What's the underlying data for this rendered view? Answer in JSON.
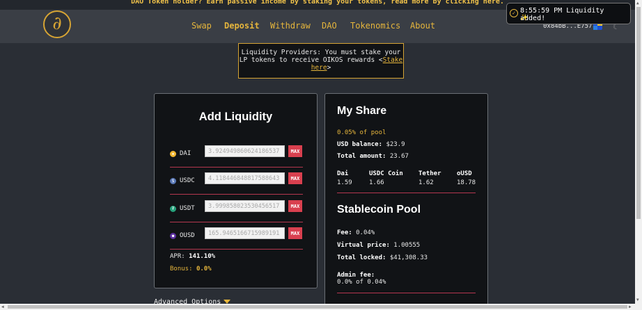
{
  "banner": {
    "text": "DAO Token holder? Earn passive income by staking your tokens, read more by clicking here."
  },
  "logo": {
    "glyph": "∂"
  },
  "nav": {
    "items": [
      {
        "label": "Swap",
        "active": false
      },
      {
        "label": "Deposit",
        "active": true
      },
      {
        "label": "Withdraw",
        "active": false
      },
      {
        "label": "DAO",
        "active": false
      },
      {
        "label": "Tokenomics",
        "active": false
      },
      {
        "label": "About",
        "active": false
      }
    ]
  },
  "wallet": {
    "address": "0x84bB...E757",
    "icon": "wallet-avatar-icon"
  },
  "theme_toggle": {
    "icon": "moon-icon"
  },
  "toast": {
    "time": "8:55:59 PM",
    "message": "8:55:59 PM Liquidity added!",
    "emoji": "✨"
  },
  "notice": {
    "text_before": "Liquidity Providers: You must stake your LP tokens to receive OIKOS rewards <",
    "link": "Stake here",
    "text_after": ">"
  },
  "add_liquidity": {
    "title": "Add Liquidity",
    "tokens": [
      {
        "name": "DAI",
        "value": "3.924949860624186537",
        "max_label": "MAX",
        "color": "#f4b731",
        "glyph": "◈"
      },
      {
        "name": "USDC",
        "value": "4.118446848817588643",
        "max_label": "MAX",
        "color": "#5a79b8",
        "glyph": "$"
      },
      {
        "name": "USDT",
        "value": "3.999858023530456517",
        "max_label": "MAX",
        "color": "#26a17b",
        "glyph": "₮"
      },
      {
        "name": "OUSD",
        "value": "165.9465166715989191",
        "max_label": "MAX",
        "color": "#5b2fa0",
        "glyph": "●"
      }
    ],
    "apr_label": "APR:",
    "apr_value": "141.10%",
    "bonus_label": "Bonus:",
    "bonus_value": "0.0%",
    "advanced_label": "Advanced Options"
  },
  "my_share": {
    "title": "My Share",
    "pool_share": "0.05% of pool",
    "usd_balance_label": "USD balance:",
    "usd_balance_value": "$23.9",
    "total_amount_label": "Total amount:",
    "total_amount_value": "23.67",
    "coins": [
      {
        "name": "Dai",
        "amount": "1.59"
      },
      {
        "name": "USDC Coin",
        "amount": "1.66"
      },
      {
        "name": "Tether",
        "amount": "1.62"
      },
      {
        "name": "oUSD",
        "amount": "18.78"
      }
    ]
  },
  "stablecoin_pool": {
    "title": "Stablecoin Pool",
    "fee_label": "Fee:",
    "fee_value": "0.04%",
    "virtual_price_label": "Virtual price:",
    "virtual_price_value": "1.00555",
    "total_locked_label": "Total locked:",
    "total_locked_value": "$41,308.33",
    "admin_fee_label": "Admin fee:",
    "admin_fee_value": "0.0% of 0.04%"
  }
}
